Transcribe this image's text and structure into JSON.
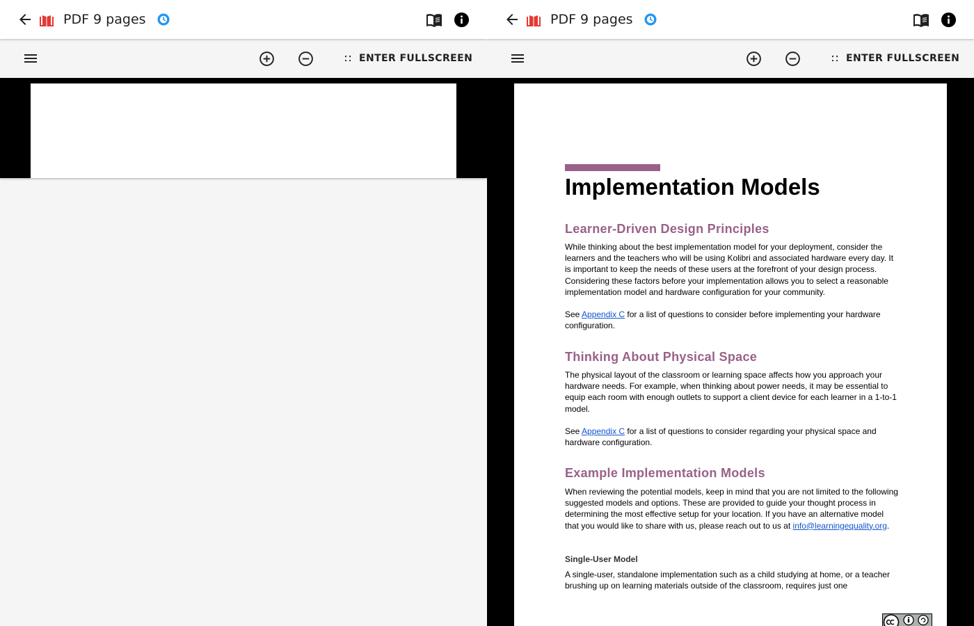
{
  "colors": {
    "accent": "#996189",
    "link": "#1155cc",
    "progress": "#2196f3",
    "doc_icon": "#e53935",
    "viewer_bg": "#000000"
  },
  "left_pane": {
    "appbar": {
      "title": "PDF 9 pages",
      "icons": [
        "back-arrow-icon",
        "pdf-document-icon",
        "progress-clock-icon",
        "book-icon",
        "info-icon"
      ]
    },
    "toolbar": {
      "fullscreen_label": "ENTER FULLSCREEN",
      "icons": [
        "menu-icon",
        "zoom-in-icon",
        "zoom-out-icon",
        "fullscreen-icon"
      ]
    }
  },
  "right_pane": {
    "appbar": {
      "title": "PDF 9 pages",
      "icons": [
        "back-arrow-icon",
        "pdf-document-icon",
        "progress-clock-icon",
        "book-icon",
        "info-icon"
      ]
    },
    "toolbar": {
      "fullscreen_label": "ENTER FULLSCREEN",
      "icons": [
        "menu-icon",
        "zoom-in-icon",
        "zoom-out-icon",
        "fullscreen-icon"
      ]
    },
    "document": {
      "title": "Implementation Models",
      "sections": [
        {
          "heading": "Learner-Driven Design Principles",
          "paragraph": "While thinking about the best implementation model for your deployment, consider the learners and the teachers who will be using Kolibri and associated hardware every day. It is important to keep the needs of these users at the forefront of your design process. Considering these factors before your implementation allows you to select a reasonable implementation model and hardware configuration for your community.",
          "see_prefix": "See ",
          "see_link": "Appendix C",
          "see_suffix": " for a list of questions to consider before implementing your hardware configuration."
        },
        {
          "heading": "Thinking About Physical Space",
          "paragraph": "The physical layout of the classroom or learning space affects how you approach your hardware needs. For example, when thinking about power needs, it may be essential to equip each room with enough outlets to support a client device for each learner in a 1-to-1 model.",
          "see_prefix": "See ",
          "see_link": "Appendix C",
          "see_suffix": " for a list of questions to consider regarding your physical space and hardware configuration."
        },
        {
          "heading": "Example Implementation Models",
          "paragraph": "When reviewing the potential models, keep in mind that you are not limited to the following suggested models and options. These are provided to guide your thought process in determining the most effective setup for your location. If you have an alternative model that you would like to share with us, please reach out to us at ",
          "email_link": "info@learningequality.org",
          "email_suffix": "."
        }
      ],
      "subsection": {
        "heading": "Single-User Model",
        "paragraph": "A single-user, standalone implementation such as a child studying at home, or a teacher brushing up on learning materials outside of the classroom, requires just one"
      },
      "license_badge_icon": "creative-commons-by-sa-icon"
    }
  }
}
